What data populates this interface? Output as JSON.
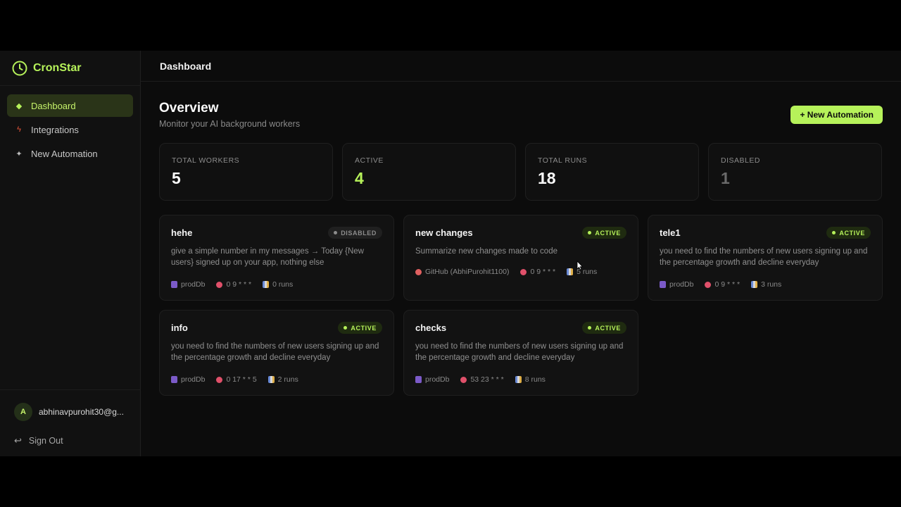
{
  "brand": {
    "name": "CronStar"
  },
  "nav": [
    {
      "label": "Dashboard",
      "icon": "diamond-icon"
    },
    {
      "label": "Integrations",
      "icon": "bolt-icon"
    },
    {
      "label": "New Automation",
      "icon": "sparkle-icon"
    }
  ],
  "user": {
    "initial": "A",
    "email": "abhinavpurohit30@g...",
    "signout": "Sign Out"
  },
  "topbar": {
    "title": "Dashboard"
  },
  "overview": {
    "title": "Overview",
    "subtitle": "Monitor your AI background workers",
    "new_button": "+ New Automation"
  },
  "stats": [
    {
      "label": "TOTAL WORKERS",
      "value": "5",
      "color": "#fafafa"
    },
    {
      "label": "ACTIVE",
      "value": "4",
      "color": "#b6f25a"
    },
    {
      "label": "TOTAL RUNS",
      "value": "18",
      "color": "#fafafa"
    },
    {
      "label": "DISABLED",
      "value": "1",
      "color": "#6a6a6a"
    }
  ],
  "workers": [
    {
      "name": "hehe",
      "status": "DISABLED",
      "desc": "give a simple number in my messages → Today {New users} signed up on your app, nothing else",
      "source": "prodDb",
      "cron": "0 9 * * *",
      "runs": "0 runs"
    },
    {
      "name": "new changes",
      "status": "ACTIVE",
      "desc": "Summarize new changes made to code",
      "source": "GitHub (AbhiPurohit1100)",
      "cron": "0 9 * * *",
      "runs": "5 runs"
    },
    {
      "name": "tele1",
      "status": "ACTIVE",
      "desc": "you need to find the numbers of new users signing up and the percentage growth and decline everyday",
      "source": "prodDb",
      "cron": "0 9 * * *",
      "runs": "3 runs"
    },
    {
      "name": "info",
      "status": "ACTIVE",
      "desc": "you need to find the numbers of new users signing up and the percentage growth and decline everyday",
      "source": "prodDb",
      "cron": "0 17 * * 5",
      "runs": "2 runs"
    },
    {
      "name": "checks",
      "status": "ACTIVE",
      "desc": "you need to find the numbers of new users signing up and the percentage growth and decline everyday",
      "source": "prodDb",
      "cron": "53 23 * * *",
      "runs": "8 runs"
    }
  ]
}
